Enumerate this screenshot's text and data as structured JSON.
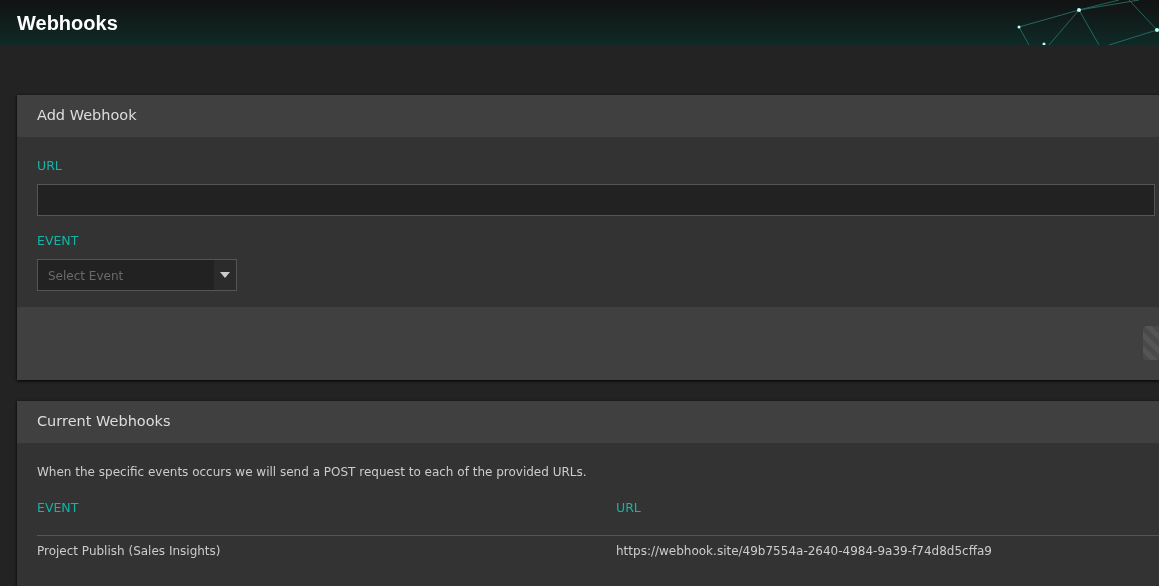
{
  "header": {
    "title": "Webhooks"
  },
  "add_webhook": {
    "title": "Add Webhook",
    "url_label": "URL",
    "event_label": "EVENT",
    "event_select": {
      "placeholder": "Select Event"
    }
  },
  "current_webhooks": {
    "title": "Current Webhooks",
    "description": "When the specific events occurs we will send a POST request to each of the provided URLs.",
    "table": {
      "columns": [
        "EVENT",
        "URL"
      ],
      "rows": [
        {
          "event": "Project Publish (Sales Insights)",
          "url": "https://webhook.site/49b7554a-2640-4984-9a39-f74d8d5cffa9"
        }
      ]
    }
  }
}
